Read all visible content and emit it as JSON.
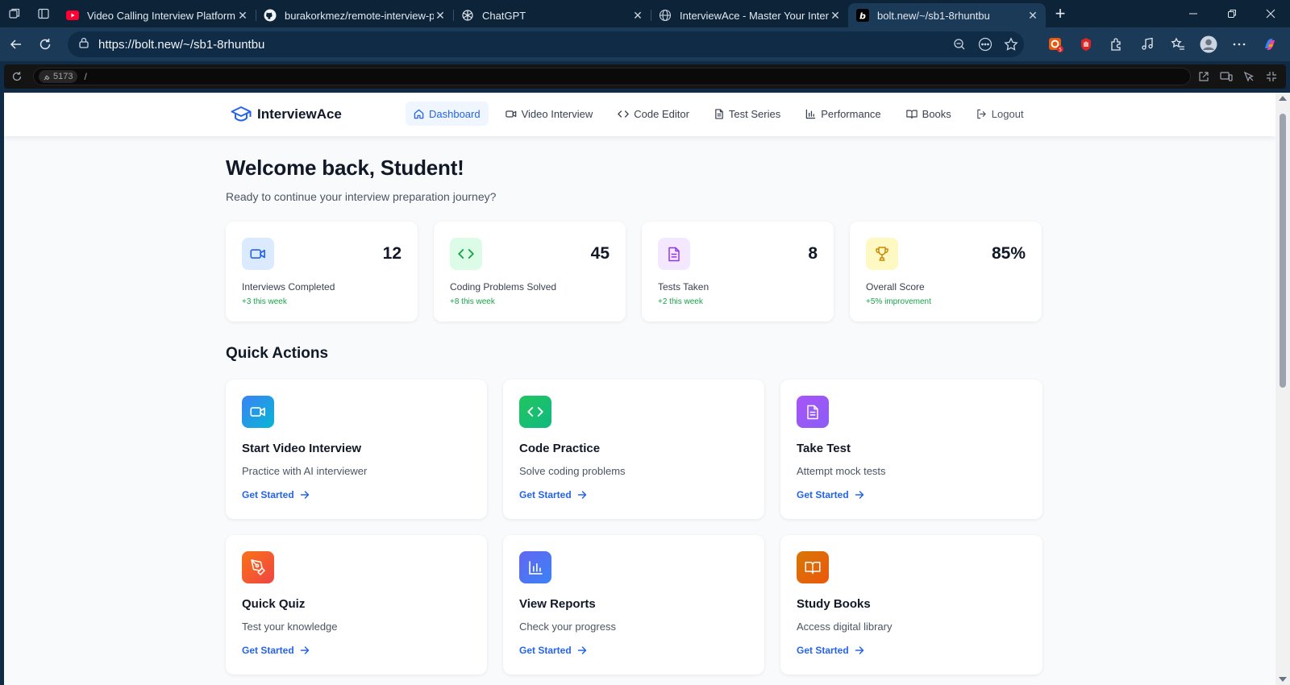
{
  "browser": {
    "tabs": [
      {
        "title": "Video Calling Interview Platform: I",
        "favicon": "youtube-icon",
        "active": false
      },
      {
        "title": "burakorkmez/remote-interview-p",
        "favicon": "github-icon",
        "active": false
      },
      {
        "title": "ChatGPT",
        "favicon": "chatgpt-icon",
        "active": false
      },
      {
        "title": "InterviewAce - Master Your Interv",
        "favicon": "globe-icon",
        "active": false
      },
      {
        "title": "bolt.new/~/sb1-8rhuntbu",
        "favicon": "bolt-icon",
        "active": true
      }
    ],
    "url": "https://bolt.new/~/sb1-8rhuntbu",
    "extension_badge": "5"
  },
  "preview": {
    "port": "5173",
    "path": "/"
  },
  "app": {
    "brand": "InterviewAce",
    "nav": [
      {
        "label": "Dashboard",
        "icon": "home-icon",
        "active": true
      },
      {
        "label": "Video Interview",
        "icon": "video-icon",
        "active": false
      },
      {
        "label": "Code Editor",
        "icon": "code-icon",
        "active": false
      },
      {
        "label": "Test Series",
        "icon": "file-text-icon",
        "active": false
      },
      {
        "label": "Performance",
        "icon": "bar-chart-icon",
        "active": false
      },
      {
        "label": "Books",
        "icon": "book-icon",
        "active": false
      },
      {
        "label": "Logout",
        "icon": "logout-icon",
        "active": false
      }
    ],
    "welcome": {
      "title": "Welcome back, Student!",
      "subtitle": "Ready to continue your interview preparation journey?"
    },
    "stats": [
      {
        "value": "12",
        "label": "Interviews Completed",
        "delta": "+3 this week",
        "icon": "video-icon",
        "bg": "#dbeafe",
        "color": "#2563eb"
      },
      {
        "value": "45",
        "label": "Coding Problems Solved",
        "delta": "+8 this week",
        "icon": "code-icon",
        "bg": "#dcfce7",
        "color": "#16a34a"
      },
      {
        "value": "8",
        "label": "Tests Taken",
        "delta": "+2 this week",
        "icon": "file-text-icon",
        "bg": "#f3e8ff",
        "color": "#9333ea"
      },
      {
        "value": "85%",
        "label": "Overall Score",
        "delta": "+5% improvement",
        "icon": "trophy-icon",
        "bg": "#fef9c3",
        "color": "#ca8a04"
      }
    ],
    "quick_actions_title": "Quick Actions",
    "actions": [
      {
        "title": "Start Video Interview",
        "desc": "Practice with AI interviewer",
        "cta": "Get Started",
        "icon": "video-icon",
        "gradient": [
          "#3b82f6",
          "#06b6d4"
        ]
      },
      {
        "title": "Code Practice",
        "desc": "Solve coding problems",
        "cta": "Get Started",
        "icon": "code-icon",
        "gradient": [
          "#22c55e",
          "#10b981"
        ]
      },
      {
        "title": "Take Test",
        "desc": "Attempt mock tests",
        "cta": "Get Started",
        "icon": "file-text-icon",
        "gradient": [
          "#a855f7",
          "#8b5cf6"
        ]
      },
      {
        "title": "Quick Quiz",
        "desc": "Test your knowledge",
        "cta": "Get Started",
        "icon": "pen-tool-icon",
        "gradient": [
          "#f97316",
          "#ef4444"
        ]
      },
      {
        "title": "View Reports",
        "desc": "Check your progress",
        "cta": "Get Started",
        "icon": "bar-chart-icon",
        "gradient": [
          "#6366f1",
          "#3b82f6"
        ]
      },
      {
        "title": "Study Books",
        "desc": "Access digital library",
        "cta": "Get Started",
        "icon": "book-icon",
        "gradient": [
          "#d97706",
          "#ea580c"
        ]
      }
    ],
    "colors": {
      "accent": "#2563eb",
      "success": "#16a34a"
    }
  }
}
